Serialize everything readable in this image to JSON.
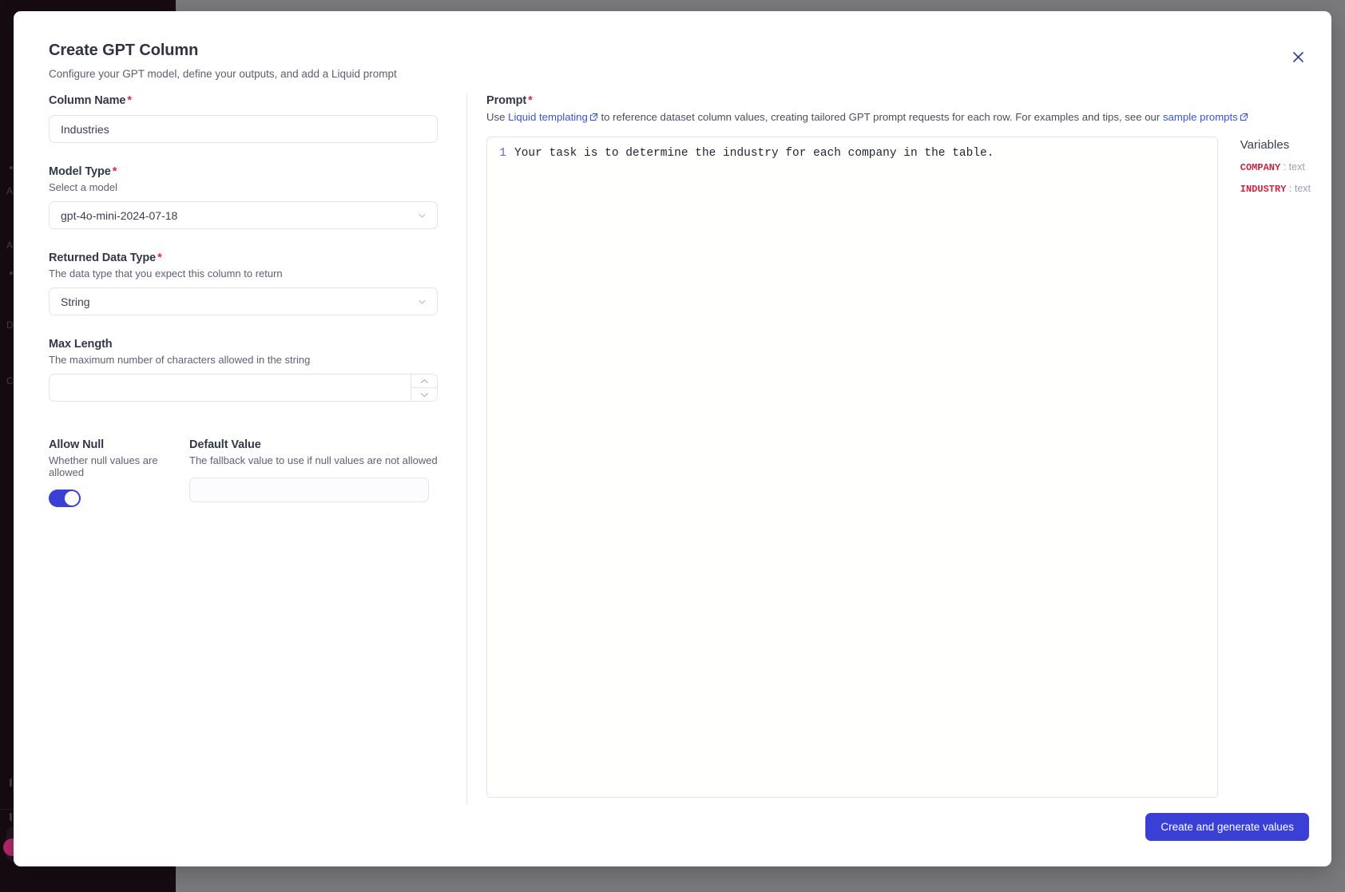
{
  "background": {
    "sidebar": {
      "logo_icon": "sparkle-logo-icon",
      "occluded_items": [
        {
          "label": "A"
        },
        {
          "label": "A"
        },
        {
          "label": "D"
        },
        {
          "label": "C"
        }
      ]
    }
  },
  "modal": {
    "title": "Create GPT Column",
    "subtitle": "Configure your GPT model, define your outputs, and add a Liquid prompt",
    "close_icon": "close-icon"
  },
  "form": {
    "column_name": {
      "label": "Column Name",
      "required_marker": "*",
      "value": "Industries",
      "placeholder": ""
    },
    "model_type": {
      "label": "Model Type",
      "required_marker": "*",
      "help": "Select a model",
      "value": "gpt-4o-mini-2024-07-18"
    },
    "returned_data_type": {
      "label": "Returned Data Type",
      "required_marker": "*",
      "help": "The data type that you expect this column to return",
      "value": "String"
    },
    "max_length": {
      "label": "Max Length",
      "help": "The maximum number of characters allowed in the string",
      "value": "",
      "placeholder": ""
    },
    "allow_null": {
      "label": "Allow Null",
      "help": "Whether null values are allowed",
      "enabled": true
    },
    "default_value": {
      "label": "Default Value",
      "help": "The fallback value to use if null values are not allowed",
      "value": "",
      "placeholder": ""
    }
  },
  "prompt": {
    "label": "Prompt",
    "required_marker": "*",
    "desc_prefix": "Use ",
    "link1_text": "Liquid templating",
    "desc_middle": " to reference dataset column values, creating tailored GPT prompt requests for each row. For examples and tips, see our ",
    "link2_text": "sample prompts",
    "line_number": "1",
    "code": "Your task is to determine the industry for each company in the table."
  },
  "variables": {
    "title": "Variables",
    "items": [
      {
        "name": "COMPANY",
        "sep": ":",
        "type": "text"
      },
      {
        "name": "INDUSTRY",
        "sep": ":",
        "type": "text"
      }
    ]
  },
  "footer": {
    "submit_label": "Create and generate values"
  },
  "colors": {
    "accent": "#3a40d6",
    "required": "#d32f4f",
    "link": "#3a55d6",
    "variable": "#c2283f",
    "sidebar_bg": "#170b12",
    "overlay": "#7a7a7d"
  }
}
